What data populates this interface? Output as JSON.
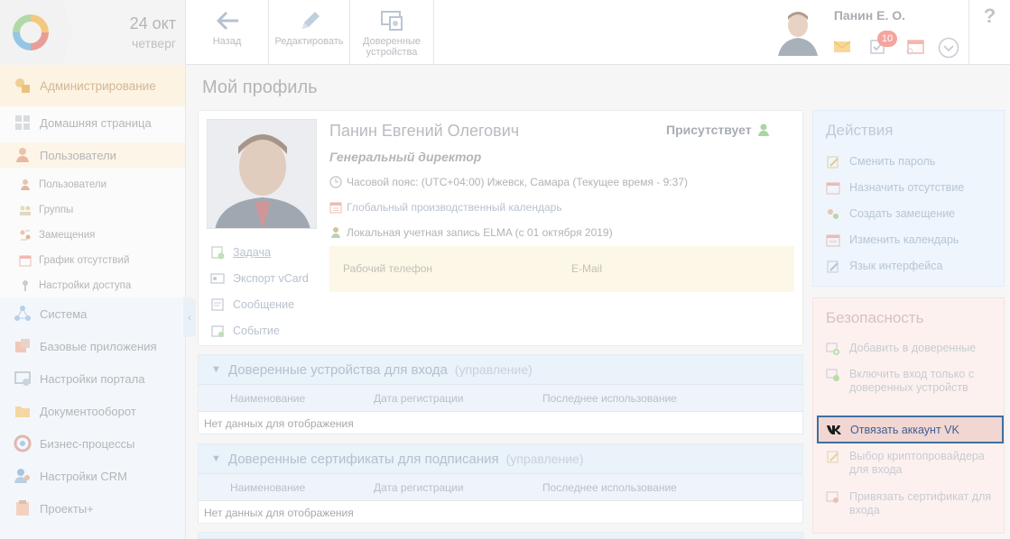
{
  "header": {
    "date_day": "24 окт",
    "date_weekday": "четверг",
    "toolbar": {
      "back_label": "Назад",
      "edit_label": "Редактировать",
      "trusted_label_1": "Доверенные",
      "trusted_label_2": "устройства"
    },
    "user_name": "Панин Е. О.",
    "notifications_count": "10",
    "help": "?"
  },
  "sidebar": {
    "admin": "Администрирование",
    "items": [
      {
        "label": "Домашняя страница",
        "level": "top"
      },
      {
        "label": "Пользователи",
        "level": "top"
      },
      {
        "label": "Пользователи",
        "level": "sub"
      },
      {
        "label": "Группы",
        "level": "sub"
      },
      {
        "label": "Замещения",
        "level": "sub"
      },
      {
        "label": "График отсутствий",
        "level": "sub"
      },
      {
        "label": "Настройки доступа",
        "level": "sub"
      },
      {
        "label": "Система",
        "level": "top"
      },
      {
        "label": "Базовые приложения",
        "level": "top"
      },
      {
        "label": "Настройки портала",
        "level": "top"
      },
      {
        "label": "Документооборот",
        "level": "top"
      },
      {
        "label": "Бизнес-процессы",
        "level": "top"
      },
      {
        "label": "Настройки CRM",
        "level": "top"
      },
      {
        "label": "Проекты+",
        "level": "top"
      }
    ]
  },
  "page": {
    "title": "Мой профиль"
  },
  "profile": {
    "full_name": "Панин Евгений Олегович",
    "presence": "Присутствует",
    "position": "Генеральный директор",
    "timezone": "Часовой пояс: (UTC+04:00) Ижевск, Самара (Текущее время - 9:37)",
    "calendar": "Глобальный производственный календарь",
    "account": "Локальная учетная запись ELMA  (с 01 октября 2019)",
    "contacts": {
      "work_phone_label": "Рабочий телефон",
      "email_label": "E-Mail"
    },
    "actions": {
      "task": "Задача",
      "vcard": "Экспорт vCard",
      "message": "Сообщение",
      "event": "Событие"
    }
  },
  "trusted_devices": {
    "title": "Доверенные устройства для входа",
    "manage": "(управление)",
    "columns": [
      "Наименование",
      "Дата регистрации",
      "Последнее использование"
    ],
    "empty": "Нет данных для отображения"
  },
  "trusted_certs": {
    "title": "Доверенные сертификаты для подписания",
    "manage": "(управление)",
    "columns": [
      "Наименование",
      "Дата регистрации",
      "Последнее использование"
    ],
    "empty": "Нет данных для отображения"
  },
  "actions_panel": {
    "title": "Действия",
    "items": [
      "Сменить пароль",
      "Назначить отсутствие",
      "Создать замещение",
      "Изменить календарь",
      "Язык интерфейса"
    ]
  },
  "security_panel": {
    "title": "Безопасность",
    "add_trusted": "Добавить в доверенные",
    "trusted_only_1": "Включить вход только с",
    "trusted_only_2": "доверенных устройств",
    "vk_unlink": "Отвязать аккаунт VK",
    "crypto_1": "Выбор криптопровайдера",
    "crypto_2": "для входа",
    "cert_1": "Привязать сертификат для",
    "cert_2": "входа"
  },
  "colors": {
    "accent_link": "#3d5f97",
    "highlight_border": "#3f6fa1",
    "notification_badge": "#f08a80"
  }
}
